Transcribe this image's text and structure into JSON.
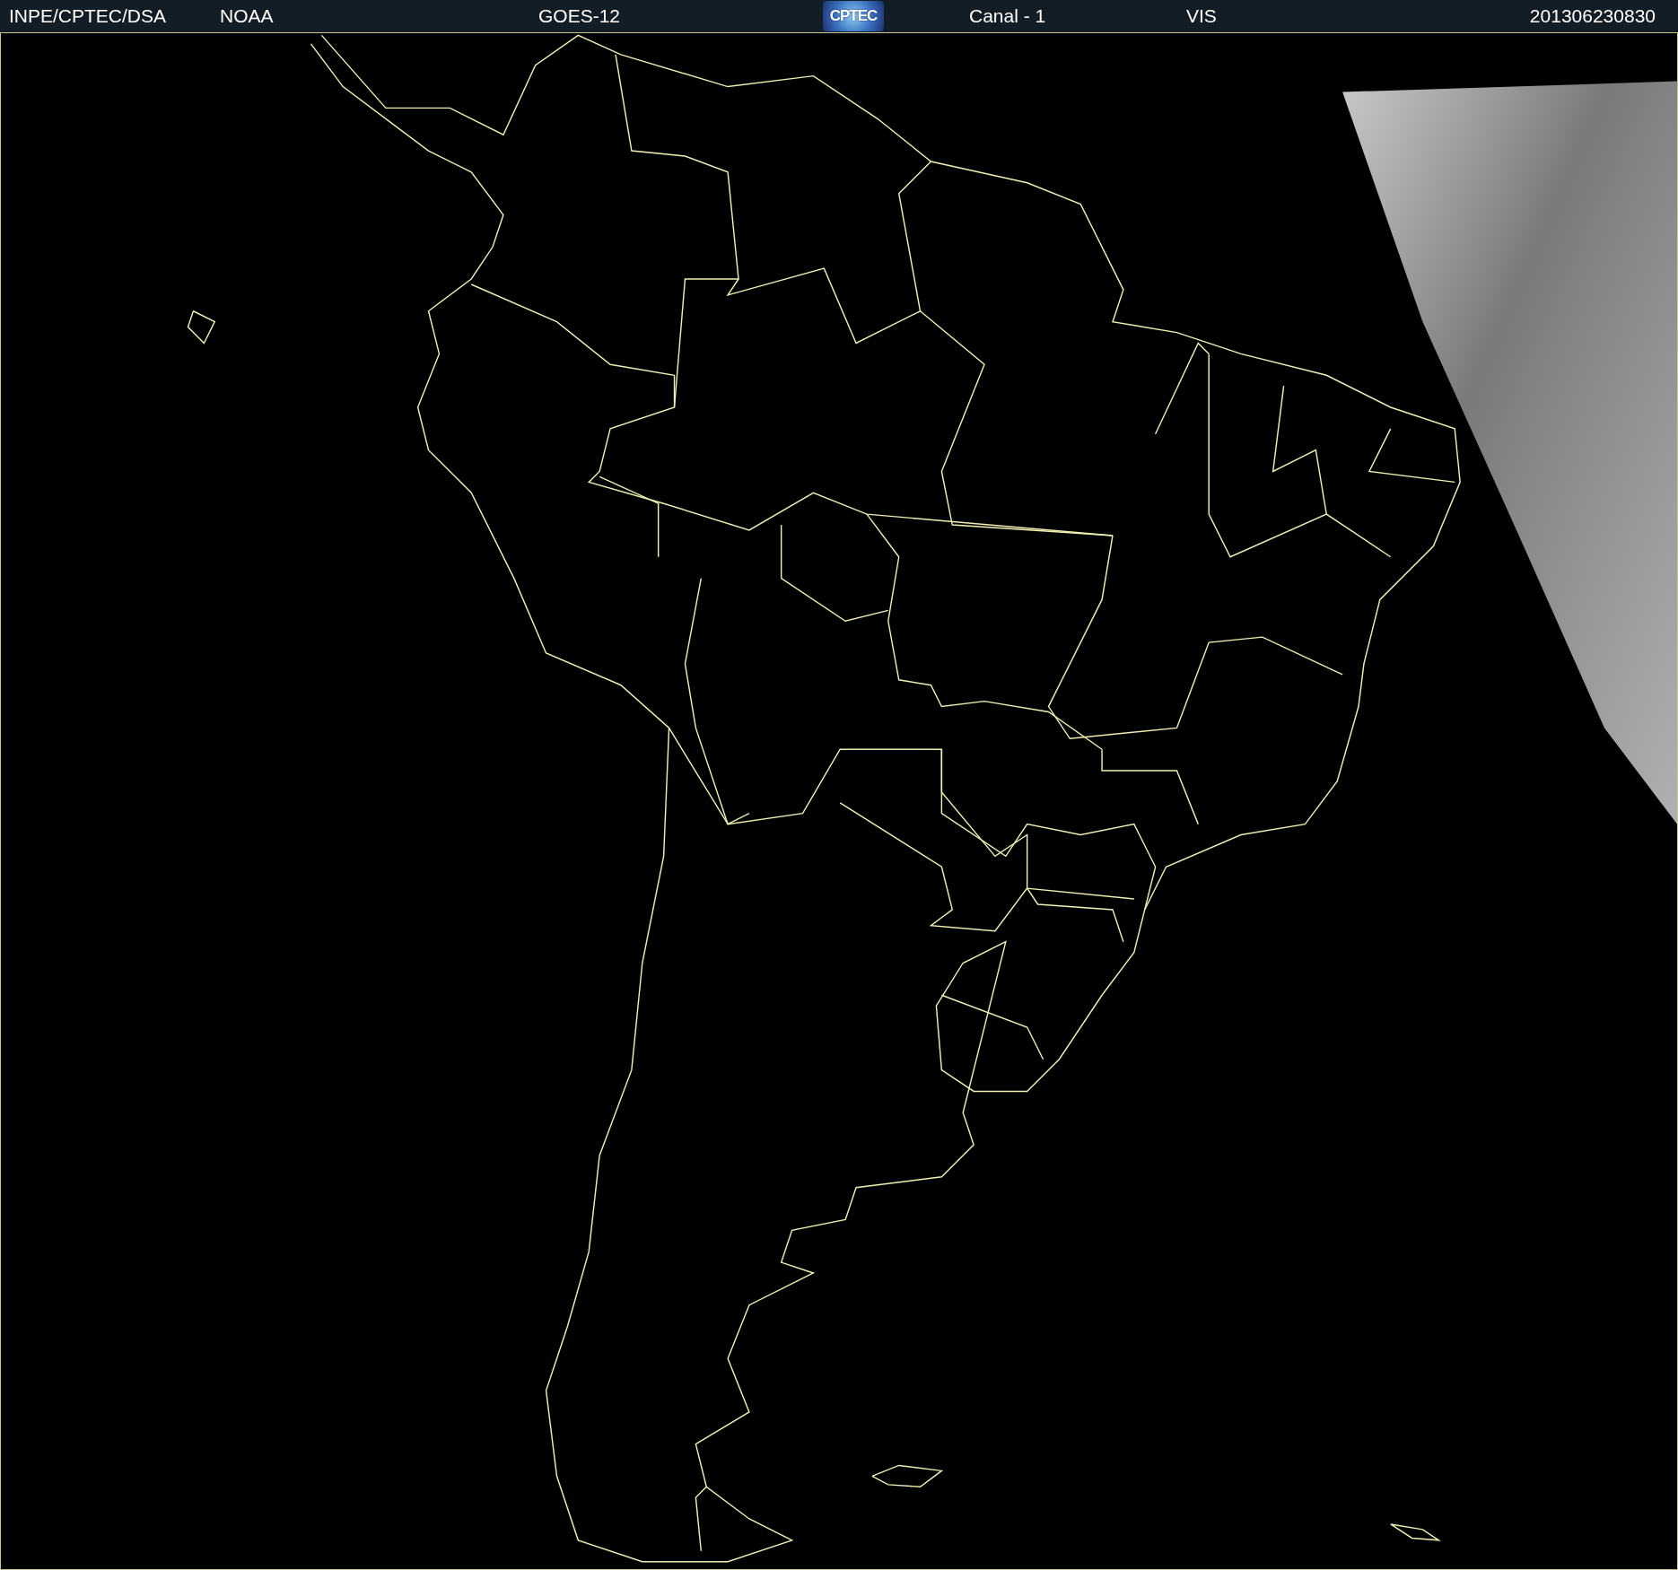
{
  "header": {
    "source": "INPE/CPTEC/DSA",
    "agency": "NOAA",
    "satellite": "GOES-12",
    "logo": "CPTEC",
    "channel": "Canal - 1",
    "band": "VIS",
    "timestamp": "201306230830"
  }
}
